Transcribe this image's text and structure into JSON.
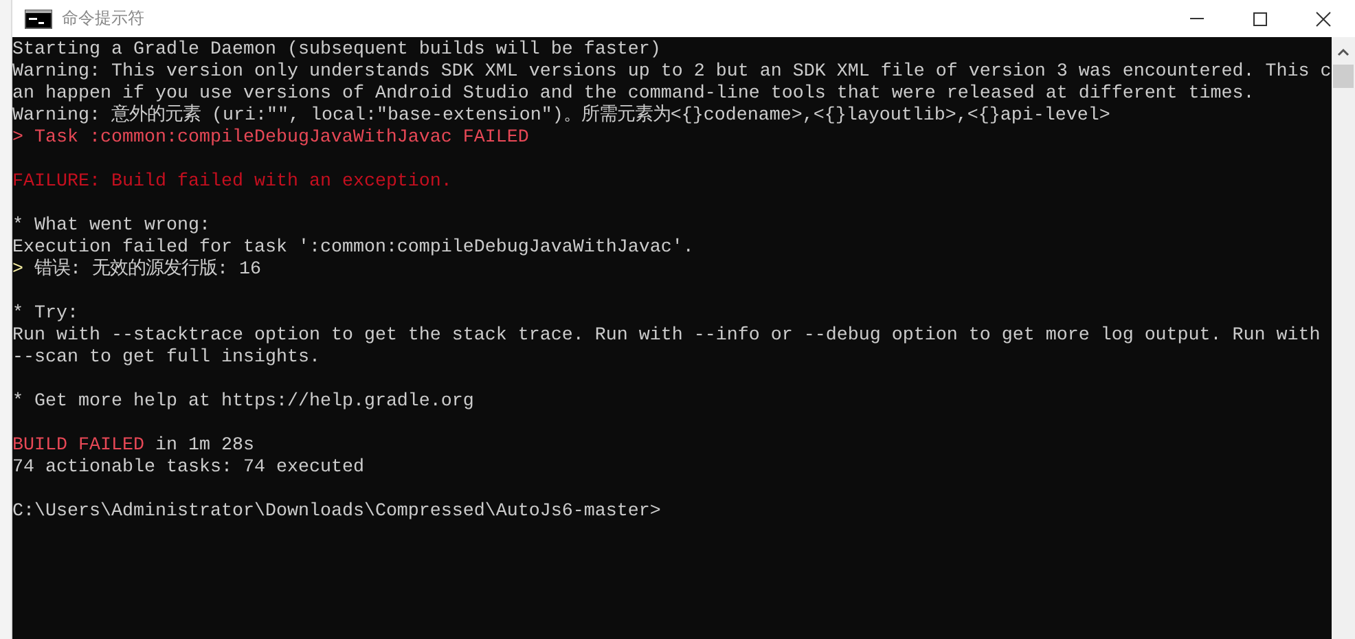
{
  "window": {
    "title": "命令提示符"
  },
  "console": {
    "lines": [
      {
        "kind": "text",
        "segments": [
          {
            "text": "Starting a Gradle Daemon (subsequent builds will be faster)",
            "color": "#cccccc"
          }
        ]
      },
      {
        "kind": "text",
        "segments": [
          {
            "text": "Warning: This version only understands SDK XML versions up to 2 but an SDK XML file of version 3 was encountered. This c",
            "color": "#cccccc"
          }
        ]
      },
      {
        "kind": "text",
        "segments": [
          {
            "text": "an happen if you use versions of Android Studio and the command-line tools that were released at different times.",
            "color": "#cccccc"
          }
        ]
      },
      {
        "kind": "text",
        "segments": [
          {
            "text": "Warning: 意外的元素 (uri:\"\", local:\"base-extension\")。所需元素为<{}codename>,<{}layoutlib>,<{}api-level>",
            "color": "#cccccc"
          }
        ]
      },
      {
        "kind": "text",
        "segments": [
          {
            "text": ">",
            "color": "#e74856"
          },
          {
            "text": "Task :common:compileDebugJavaWithJavac FAILED",
            "color": "#e74856"
          }
        ]
      },
      {
        "kind": "blank"
      },
      {
        "kind": "text",
        "segments": [
          {
            "text": "FAILURE: Build failed with an exception.",
            "color": "#c50f1f"
          }
        ]
      },
      {
        "kind": "blank"
      },
      {
        "kind": "text",
        "segments": [
          {
            "text": "* What went wrong:",
            "color": "#cccccc"
          }
        ]
      },
      {
        "kind": "text",
        "segments": [
          {
            "text": "Execution failed for task ':common:compileDebugJavaWithJavac'.",
            "color": "#cccccc"
          }
        ]
      },
      {
        "kind": "text",
        "segments": [
          {
            "text": ">",
            "color": "#f9f1a5"
          },
          {
            "text": "错误: 无效的源发行版: 16",
            "color": "#cccccc"
          }
        ]
      },
      {
        "kind": "blank"
      },
      {
        "kind": "text",
        "segments": [
          {
            "text": "* Try:",
            "color": "#cccccc"
          }
        ]
      },
      {
        "kind": "text",
        "segments": [
          {
            "text": "Run with --stacktrace option to get the stack trace. Run with --info or --debug option to get more log output. Run with",
            "color": "#cccccc"
          }
        ]
      },
      {
        "kind": "text",
        "segments": [
          {
            "text": "--scan to get full insights.",
            "color": "#cccccc"
          }
        ]
      },
      {
        "kind": "blank"
      },
      {
        "kind": "text",
        "segments": [
          {
            "text": "* Get more help at https://help.gradle.org",
            "color": "#cccccc"
          }
        ]
      },
      {
        "kind": "blank"
      },
      {
        "kind": "text",
        "segments": [
          {
            "text": "BUILD FAILED",
            "color": "#e74856"
          },
          {
            "text": "in 1m 28s",
            "color": "#cccccc"
          }
        ]
      },
      {
        "kind": "text",
        "segments": [
          {
            "text": "74 actionable tasks: 74 executed",
            "color": "#cccccc"
          }
        ]
      },
      {
        "kind": "blank"
      },
      {
        "kind": "text",
        "segments": [
          {
            "text": "C:\\Users\\Administrator\\Downloads\\Compressed\\AutoJs6-master>",
            "color": "#cccccc"
          }
        ]
      }
    ]
  }
}
